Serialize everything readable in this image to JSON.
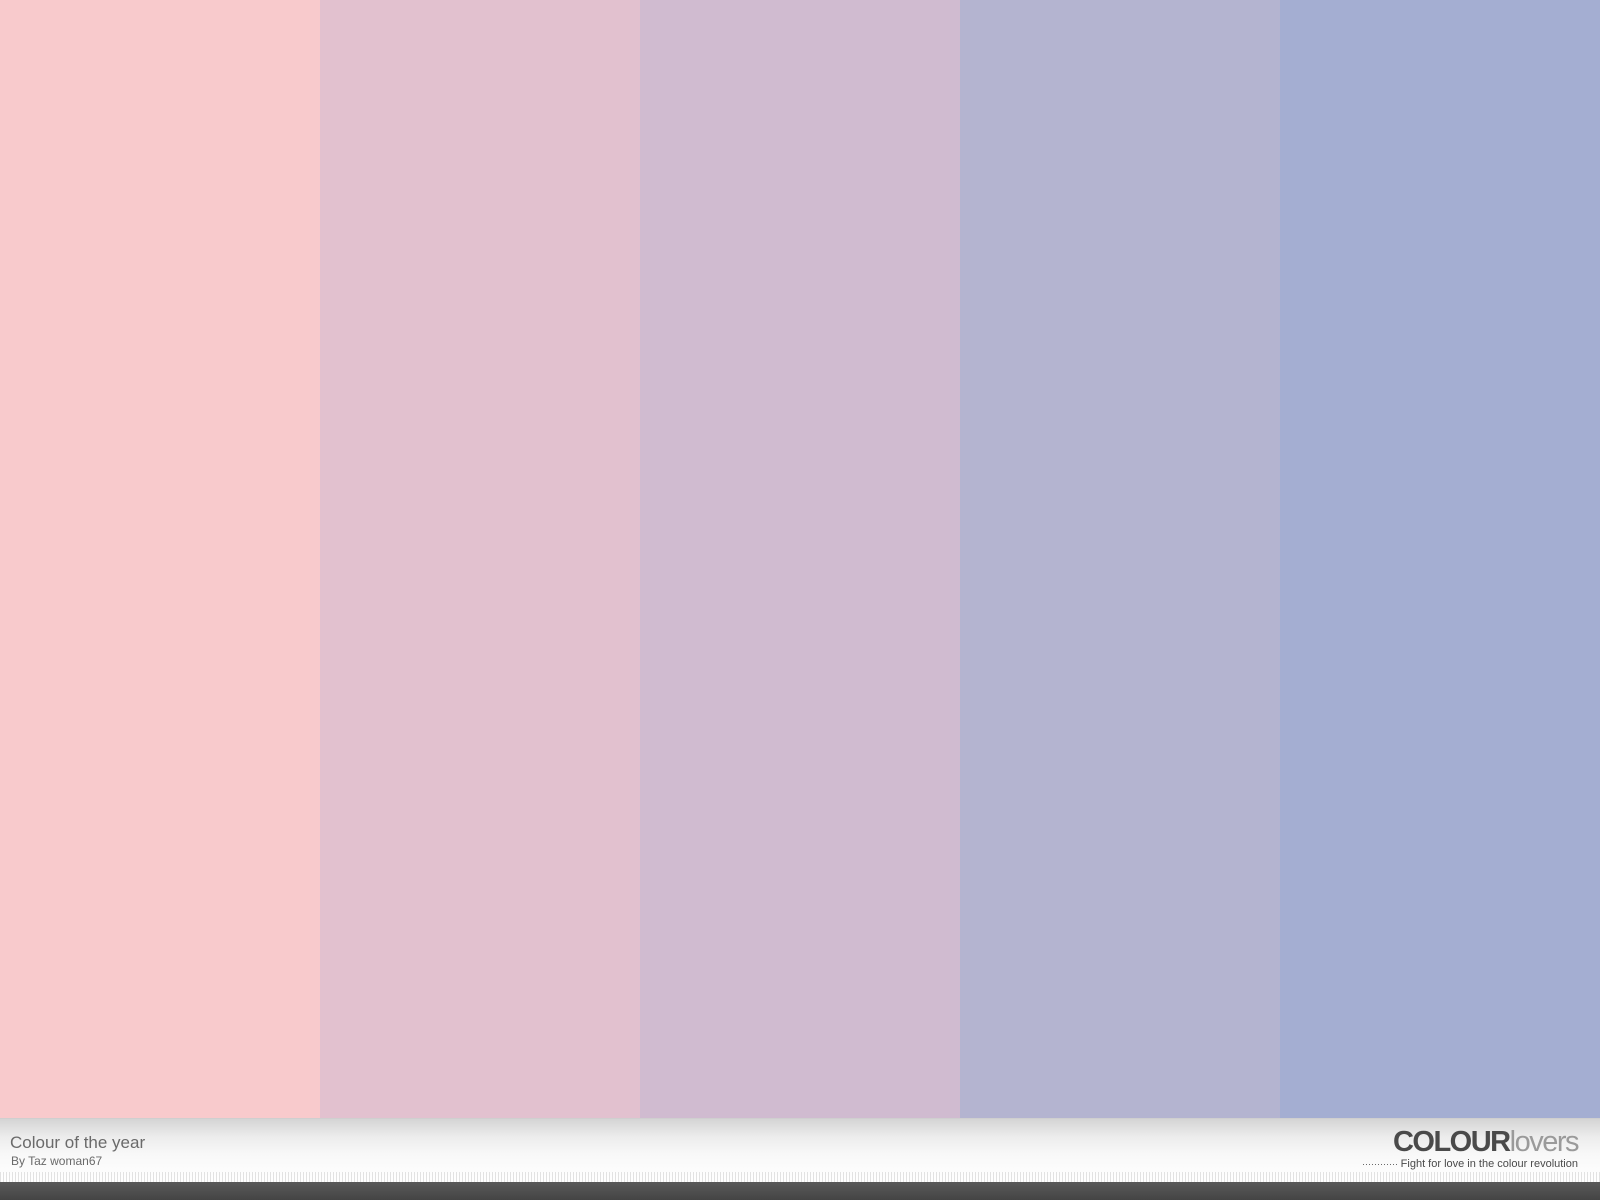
{
  "palette": {
    "title": "Colour of the year",
    "byline": "By Taz woman67",
    "colors": [
      "#F8CACC",
      "#E2C1CF",
      "#D0BBD0",
      "#B4B4D0",
      "#A4AED2"
    ]
  },
  "brand": {
    "logo_strong": "COLOUR",
    "logo_light": "lovers",
    "tagline": "Fight for love in the colour revolution"
  }
}
